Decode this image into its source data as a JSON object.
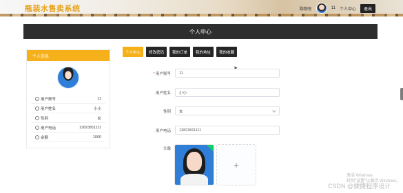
{
  "header": {
    "site_title": "瓶装水售卖系统",
    "cart_label": "购物车",
    "user_count": "11",
    "profile_link": "个人中心",
    "logout_button": "退出"
  },
  "page_title": "个人中心",
  "profile_card": {
    "title": "个人信息",
    "rows": [
      {
        "label": "用户账号",
        "value": "11"
      },
      {
        "label": "用户姓名",
        "value": "小小"
      },
      {
        "label": "性别",
        "value": "女"
      },
      {
        "label": "用户电话",
        "value": "13823811111"
      },
      {
        "label": "余额",
        "value": "1000"
      }
    ]
  },
  "tabs": [
    "个人中心",
    "修改密码",
    "我的订单",
    "我的地址",
    "我的收藏"
  ],
  "form": {
    "account_label": "用户账号",
    "account_value": "11",
    "name_label": "用户姓名",
    "name_value": "小小",
    "gender_label": "性别",
    "gender_value": "女",
    "phone_label": "用户电话",
    "phone_value": "13823811111",
    "avatar_label": "头像",
    "upload_plus": "+"
  },
  "watermarks": {
    "windows_line1": "激活 Windows",
    "windows_line2": "转到\"设置\"以激活 Windows。",
    "csdn": "CSDN @便捷程序设计"
  },
  "colors": {
    "accent": "#f5b01a",
    "dark": "#2e2e2e",
    "title": "#e6a21a"
  }
}
